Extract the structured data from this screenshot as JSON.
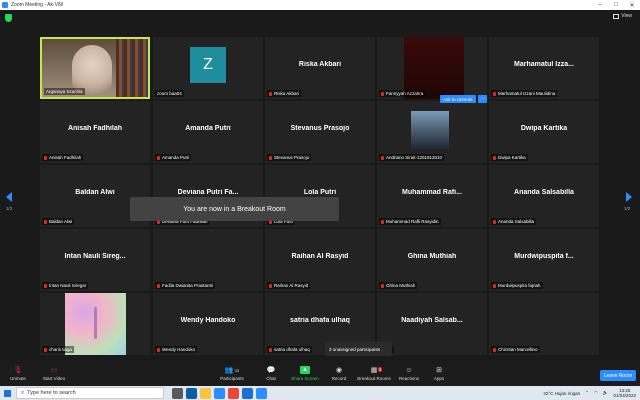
{
  "window": {
    "title": "Zoom Meeting - Ak-V8il"
  },
  "view_label": "View",
  "tiles": [
    {
      "name": "",
      "label": "Arganaya Szachia",
      "kind": "video-person",
      "muted": false,
      "active": true
    },
    {
      "name": "",
      "label": "zoom baa04",
      "kind": "avatar",
      "avatar_letter": "Z",
      "muted": false
    },
    {
      "name": "Riska Akbari",
      "label": "Riska Akbari",
      "kind": "name",
      "muted": true
    },
    {
      "name": "",
      "label": "Fannyyah Azzahra",
      "kind": "video-dark",
      "muted": true
    },
    {
      "name": "Marhamatul Izza...",
      "label": "Marhamatul Izzani Maulidina",
      "kind": "name",
      "muted": true
    },
    {
      "name": "Anisah Fadhilah",
      "label": "Anisah Fadhilah",
      "kind": "name",
      "muted": true
    },
    {
      "name": "Amanda Putri",
      "label": "Amanda Putri",
      "kind": "name",
      "muted": true
    },
    {
      "name": "Stevanus Prasojo",
      "label": "Stevanus Prasojo",
      "kind": "name",
      "muted": true
    },
    {
      "name": "",
      "label": "Andriano Sirait-1201912010",
      "kind": "video-small",
      "muted": true
    },
    {
      "name": "Dwipa Kartika",
      "label": "Dwipa Kartika",
      "kind": "name",
      "muted": true
    },
    {
      "name": "Baldan Alwi",
      "label": "Baldan Alwi",
      "kind": "name",
      "muted": true
    },
    {
      "name": "Deviana Putri Fa...",
      "label": "Deviana Putri Fadhilah",
      "kind": "name",
      "muted": true
    },
    {
      "name": "Lola Putri",
      "label": "Lola Putri",
      "kind": "name",
      "muted": true
    },
    {
      "name": "Muhammad Rafi...",
      "label": "Muhammad Rafli Rasyidin",
      "kind": "name",
      "muted": true
    },
    {
      "name": "Ananda Salsabilla",
      "label": "Ananda Salsabilla",
      "kind": "name",
      "muted": true
    },
    {
      "name": "Intan Nauli Sireg...",
      "label": "Intan Nauli Siregar",
      "kind": "name",
      "muted": true
    },
    {
      "name": "",
      "label": "Fadila Dwianita Prastantri",
      "kind": "name",
      "muted": true
    },
    {
      "name": "Raihan Al Rasyid",
      "label": "Raihan Al Rasyid",
      "kind": "name",
      "muted": true
    },
    {
      "name": "Ghina Muthiah",
      "label": "Ghina Muthiah",
      "kind": "name",
      "muted": true
    },
    {
      "name": "Murdwipuspita f...",
      "label": "Murdwipuspita fajriah",
      "kind": "name",
      "muted": true
    },
    {
      "name": "",
      "label": "charis tiaga",
      "kind": "butterfly",
      "muted": true
    },
    {
      "name": "Wendy Handoko",
      "label": "Wendy Handoko",
      "kind": "name",
      "muted": true
    },
    {
      "name": "satria dhafa ulhaq",
      "label": "satria dhafa ulhaq",
      "kind": "name",
      "muted": true
    },
    {
      "name": "Naadiyah Salsab...",
      "label": "iah",
      "kind": "name",
      "muted": true
    },
    {
      "name": "",
      "label": "Christian Marcellino",
      "kind": "name",
      "muted": true
    }
  ],
  "ask_to_unmute": "Ask to Unmute",
  "more_dots": "···",
  "toast": "You are now in a Breakout Room",
  "unassigned": "3 unassigned participants",
  "page": {
    "current": "1/2"
  },
  "toolbar": {
    "unmute": "Unmute",
    "start_video": "Start Video",
    "participants": "Participants",
    "participants_count": "33",
    "chat": "Chat",
    "share_screen": "Share Screen",
    "record": "Record",
    "breakout_rooms": "Breakout Rooms",
    "breakout_badge": "3",
    "reactions": "Reactions",
    "apps": "Apps",
    "leave": "Leave Room"
  },
  "taskbar": {
    "search_placeholder": "Type here to search",
    "weather": "32°C  Hujan ringan",
    "time": "13:25",
    "date": "01/04/2022"
  },
  "colors": {
    "accent": "#2d8cff",
    "active_border": "#c7e84a",
    "green": "#23d959",
    "red": "#e02828"
  }
}
